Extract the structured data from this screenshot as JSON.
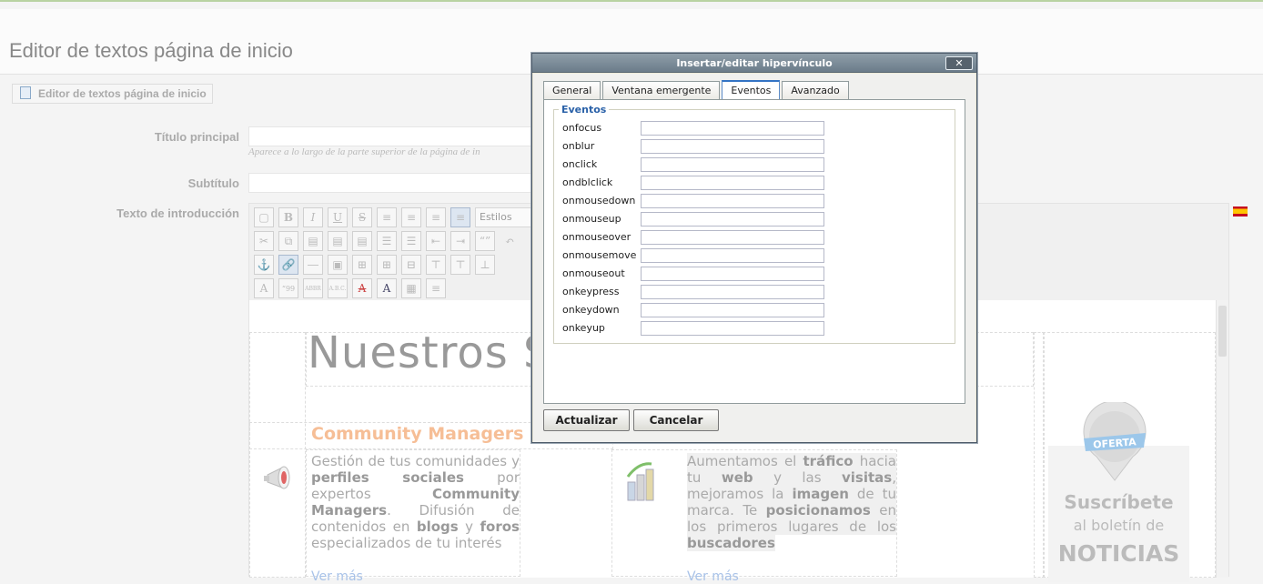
{
  "page": {
    "title": "Editor de textos página de inicio",
    "fieldset_tab": "Editor de textos página de inicio"
  },
  "form": {
    "titulo_label": "Título principal",
    "titulo_hint": "Aparece a lo largo de la parte superior de la página de in",
    "subtitulo_label": "Subtítulo",
    "intro_label": "Texto de introducción"
  },
  "toolbar": {
    "styles_select": "Estilos",
    "bold": "B",
    "italic": "I",
    "underline": "U",
    "strike": "S",
    "quote": "“”"
  },
  "editor_content": {
    "heading": "Nuestros S",
    "cm_title": "Community Managers",
    "left_para": [
      {
        "t": "Gestión de tus comunidades y ",
        "b": false
      },
      {
        "t": "perfiles sociales",
        "b": true
      },
      {
        "t": " por expertos ",
        "b": false
      },
      {
        "t": "Community Managers",
        "b": true
      },
      {
        "t": ". Difusión de contenidos en ",
        "b": false
      },
      {
        "t": "blogs",
        "b": true
      },
      {
        "t": " y ",
        "b": false
      },
      {
        "t": "foros",
        "b": true
      },
      {
        "t": " especializados de tu interés",
        "b": false
      }
    ],
    "right_para": [
      {
        "t": "Aumentamos el ",
        "b": false
      },
      {
        "t": "tráfico",
        "b": true
      },
      {
        "t": " hacia tu ",
        "b": false
      },
      {
        "t": "web",
        "b": true
      },
      {
        "t": " y las ",
        "b": false
      },
      {
        "t": "visitas",
        "b": true
      },
      {
        "t": ", mejoramos la ",
        "b": false
      },
      {
        "t": "imagen",
        "b": true
      },
      {
        "t": " de tu marca. Te ",
        "b": false
      },
      {
        "t": "posicionamos",
        "b": true
      },
      {
        "t": " en los primeros lugares de los ",
        "b": false
      },
      {
        "t": "buscadores",
        "b": true
      }
    ],
    "more_left": "Ver más",
    "more_right": "Ver más",
    "promo_badge": "OFERTA",
    "promo_line1": "Suscríbete",
    "promo_line2": "al boletín de",
    "promo_line3": "NOTICIAS"
  },
  "dialog": {
    "title": "Insertar/editar hipervínculo",
    "close_label": "✕",
    "tabs": [
      "General",
      "Ventana emergente",
      "Eventos",
      "Avanzado"
    ],
    "active_tab": "Eventos",
    "legend": "Eventos",
    "events": [
      {
        "name": "onfocus",
        "value": ""
      },
      {
        "name": "onblur",
        "value": ""
      },
      {
        "name": "onclick",
        "value": ""
      },
      {
        "name": "ondblclick",
        "value": ""
      },
      {
        "name": "onmousedown",
        "value": ""
      },
      {
        "name": "onmouseup",
        "value": ""
      },
      {
        "name": "onmouseover",
        "value": ""
      },
      {
        "name": "onmousemove",
        "value": ""
      },
      {
        "name": "onmouseout",
        "value": ""
      },
      {
        "name": "onkeypress",
        "value": ""
      },
      {
        "name": "onkeydown",
        "value": ""
      },
      {
        "name": "onkeyup",
        "value": ""
      }
    ],
    "update_button": "Actualizar",
    "cancel_button": "Cancelar"
  },
  "colors": {
    "accent_orange": "#f6be96",
    "link_blue": "#a8c2e8",
    "dialog_title_bg": "#6b7c8a",
    "legend_blue": "#2a61a8"
  },
  "icons": [
    "document-icon",
    "spain-flag-icon",
    "megaphone-icon",
    "bar-chart-icon",
    "oferta-badge-icon",
    "close-icon"
  ]
}
